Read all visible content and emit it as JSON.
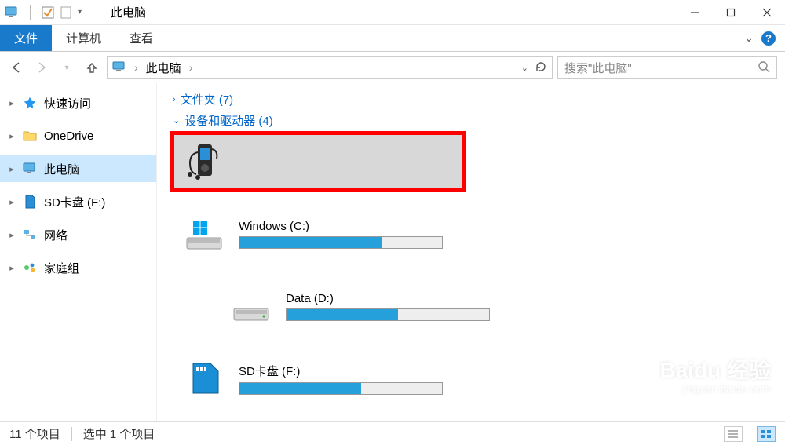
{
  "window": {
    "title": "此电脑"
  },
  "ribbon": {
    "file": "文件",
    "tabs": [
      "计算机",
      "查看"
    ]
  },
  "nav": {
    "breadcrumb": "此电脑",
    "search_placeholder": "搜索\"此电脑\""
  },
  "sidebar": {
    "items": [
      {
        "label": "快速访问",
        "icon": "star"
      },
      {
        "label": "OneDrive",
        "icon": "folder"
      },
      {
        "label": "此电脑",
        "icon": "pc",
        "selected": true
      },
      {
        "label": "SD卡盘 (F:)",
        "icon": "sd"
      },
      {
        "label": "网络",
        "icon": "network"
      },
      {
        "label": "家庭组",
        "icon": "homegroup"
      }
    ]
  },
  "content": {
    "folders_group": "文件夹 (7)",
    "devices_group": "设备和驱动器 (4)",
    "devices": [
      {
        "name": "",
        "icon": "mp3",
        "selected": true
      },
      {
        "name": "Windows (C:)",
        "icon": "drive-win",
        "fill_pct": 70
      },
      {
        "name": "Data (D:)",
        "icon": "drive",
        "fill_pct": 55
      },
      {
        "name": "SD卡盘 (F:)",
        "icon": "sd-big",
        "fill_pct": 60
      }
    ]
  },
  "status": {
    "items_count": "11 个项目",
    "selected_count": "选中 1 个项目"
  },
  "watermark": {
    "main": "Baidu 经验",
    "sub": "jingyan.baidu.com"
  }
}
